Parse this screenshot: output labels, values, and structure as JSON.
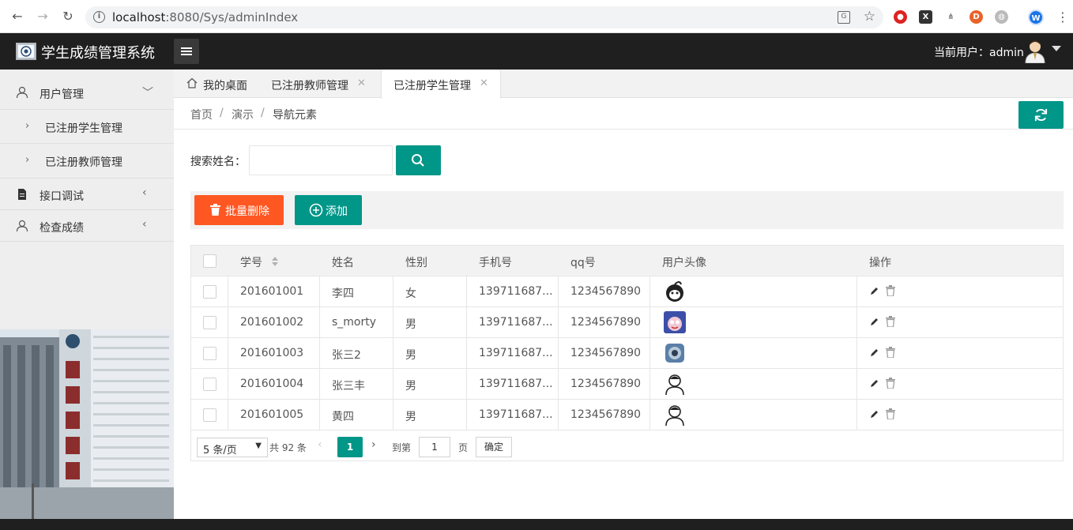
{
  "browser": {
    "url_host": "localhost",
    "url_rest": ":8080/Sys/adminIndex",
    "profile_initial": "W"
  },
  "header": {
    "logo_text": "校徽",
    "title": "学生成绩管理系统",
    "current_user": "当前用户：admin"
  },
  "sidebar": {
    "groups": [
      {
        "label": "用户管理",
        "arrow": "﹀"
      },
      {
        "label": "接口调试",
        "arrow": "‹"
      },
      {
        "label": "检查成绩",
        "arrow": "‹"
      }
    ],
    "sub_items": [
      {
        "label": "已注册学生管理",
        "arrow": "›"
      },
      {
        "label": "已注册教师管理",
        "arrow": "›"
      }
    ]
  },
  "tabs": [
    {
      "label": "我的桌面"
    },
    {
      "label": "已注册教师管理",
      "close": "✕"
    },
    {
      "label": "已注册学生管理",
      "close": "✕"
    }
  ],
  "breadcrumb": {
    "items": [
      "首页",
      "演示",
      "导航元素"
    ],
    "sep": "/"
  },
  "search": {
    "label": "搜索姓名：",
    "value": ""
  },
  "toolbar": {
    "batch_delete": "批量删除",
    "add": "添加"
  },
  "table": {
    "headers": [
      "学号",
      "姓名",
      "性别",
      "手机号",
      "qq号",
      "用户头像",
      "操作"
    ],
    "rows": [
      {
        "id": "201601001",
        "name": "李四",
        "gender": "女",
        "phone": "139711687...",
        "qq": "1234567890"
      },
      {
        "id": "201601002",
        "name": "s_morty",
        "gender": "男",
        "phone": "139711687...",
        "qq": "1234567890"
      },
      {
        "id": "201601003",
        "name": "张三2",
        "gender": "男",
        "phone": "139711687...",
        "qq": "1234567890"
      },
      {
        "id": "201601004",
        "name": "张三丰",
        "gender": "男",
        "phone": "139711687...",
        "qq": "1234567890"
      },
      {
        "id": "201601005",
        "name": "黄四",
        "gender": "男",
        "phone": "139711687...",
        "qq": "1234567890"
      }
    ]
  },
  "pager": {
    "page_size": "5 条/页",
    "total": "共 92 条",
    "current": "1",
    "goto_label": "到第",
    "goto_value": "1",
    "page_unit": "页",
    "confirm": "确定"
  },
  "colors": {
    "primary": "#009688",
    "danger": "#ff5722",
    "header_bg": "#1f1f1f"
  }
}
